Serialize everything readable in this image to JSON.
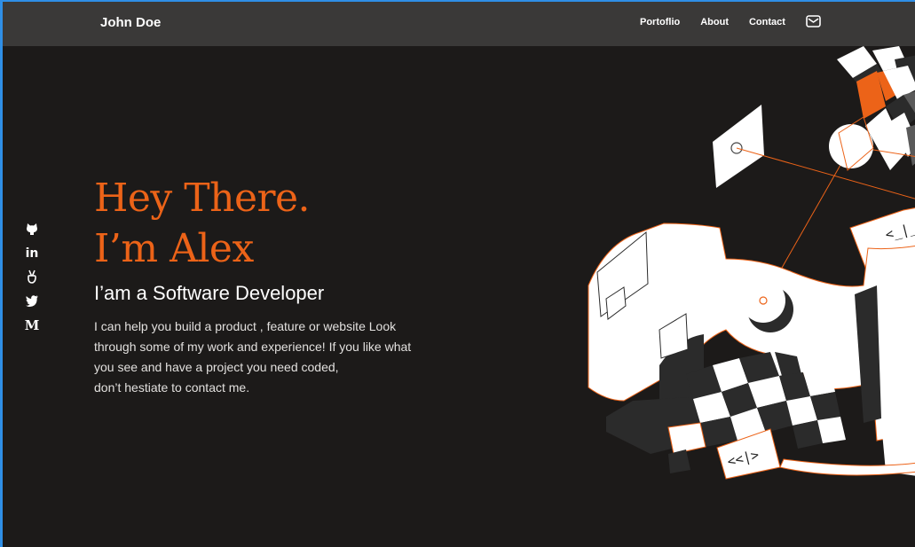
{
  "header": {
    "brand": "John Doe",
    "nav": [
      {
        "label": "Portoflio"
      },
      {
        "label": "About"
      },
      {
        "label": "Contact"
      }
    ],
    "mail_icon": "mail-icon"
  },
  "social": [
    {
      "icon": "github-icon"
    },
    {
      "icon": "linkedin-icon",
      "text": "in"
    },
    {
      "icon": "angellist-icon"
    },
    {
      "icon": "twitter-icon"
    },
    {
      "icon": "medium-icon",
      "text": "M"
    }
  ],
  "hero": {
    "title_line1": "Hey There.",
    "title_line2": "I’m Alex",
    "role": "I’am a Software Developer",
    "bio_lines": [
      "I can help you build a product , feature or website Look",
      "through some of my work and experience! If you like what",
      "you see and have a project you need coded,",
      "don’t hestiate to contact me."
    ]
  },
  "illustration": {
    "code_label_1": "<_|_",
    "code_label_2": "<<|>"
  },
  "colors": {
    "accent": "#ec6318",
    "background": "#1c1a19",
    "header": "#3a3938",
    "frame_border": "#2f8fe6"
  }
}
